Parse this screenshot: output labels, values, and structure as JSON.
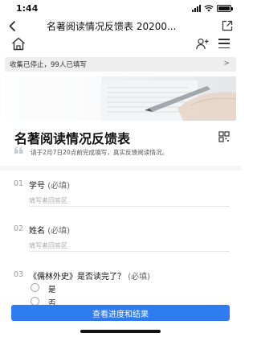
{
  "status_bar": {
    "time": "1:44"
  },
  "nav": {
    "title": "名著阅读情况反馈表 20200..."
  },
  "notice": {
    "text": "收集已停止，99人已填写",
    "arrow": ">"
  },
  "form": {
    "title": "名著阅读情况反馈表",
    "description": "请于2月7日20点前完成填写，真实反馈阅读情况。"
  },
  "questions": [
    {
      "number": "01",
      "title": "学号",
      "required": "(必填)",
      "placeholder": "填写者回答区"
    },
    {
      "number": "02",
      "title": "姓名",
      "required": "(必填)",
      "placeholder": "填写者回答区"
    },
    {
      "number": "03",
      "title": "《儒林外史》是否读完了？",
      "required": "(必填)",
      "options": [
        "是",
        "否"
      ]
    }
  ],
  "bottom_button": {
    "label": "查看进度和结果"
  },
  "colors": {
    "primary": "#2f7bf0",
    "notice_bg": "#eeeeee"
  }
}
